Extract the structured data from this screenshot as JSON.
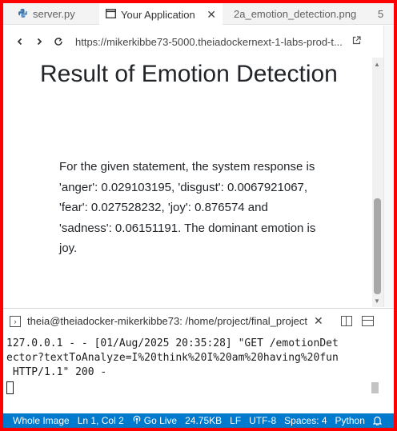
{
  "tabs": [
    {
      "label": "server.py",
      "icon": "python-icon"
    },
    {
      "label": "Your Application",
      "icon": "browser-icon",
      "active": true
    },
    {
      "label": "2a_emotion_detection.png",
      "icon": "image-icon"
    },
    {
      "label": "5",
      "icon": "more-tabs"
    }
  ],
  "browser": {
    "url": "https://mikerkibbe73-5000.theiadockernext-1-labs-prod-t..."
  },
  "page": {
    "title": "Result of Emotion Detection",
    "result": "For the given statement, the system response is 'anger': 0.029103195, 'disgust': 0.0067921067, 'fear': 0.027528232, 'joy': 0.876574 and 'sadness': 0.06151191. The dominant emotion is joy."
  },
  "terminal": {
    "title": "theia@theiadocker-mikerkibbe73: /home/project/final_project",
    "lines": [
      "127.0.0.1 - - [01/Aug/2025 20:35:28] \"GET /emotionDet",
      "ector?textToAnalyze=I%20think%20I%20am%20having%20fun",
      " HTTP/1.1\" 200 -"
    ]
  },
  "statusbar": {
    "whole_image": "Whole Image",
    "position": "Ln 1, Col 2",
    "go_live": "Go Live",
    "size": "24.75KB",
    "eol": "LF",
    "encoding": "UTF-8",
    "spaces": "Spaces: 4",
    "language": "Python"
  },
  "colors": {
    "accent": "#007acc",
    "border": "#ff0000"
  }
}
